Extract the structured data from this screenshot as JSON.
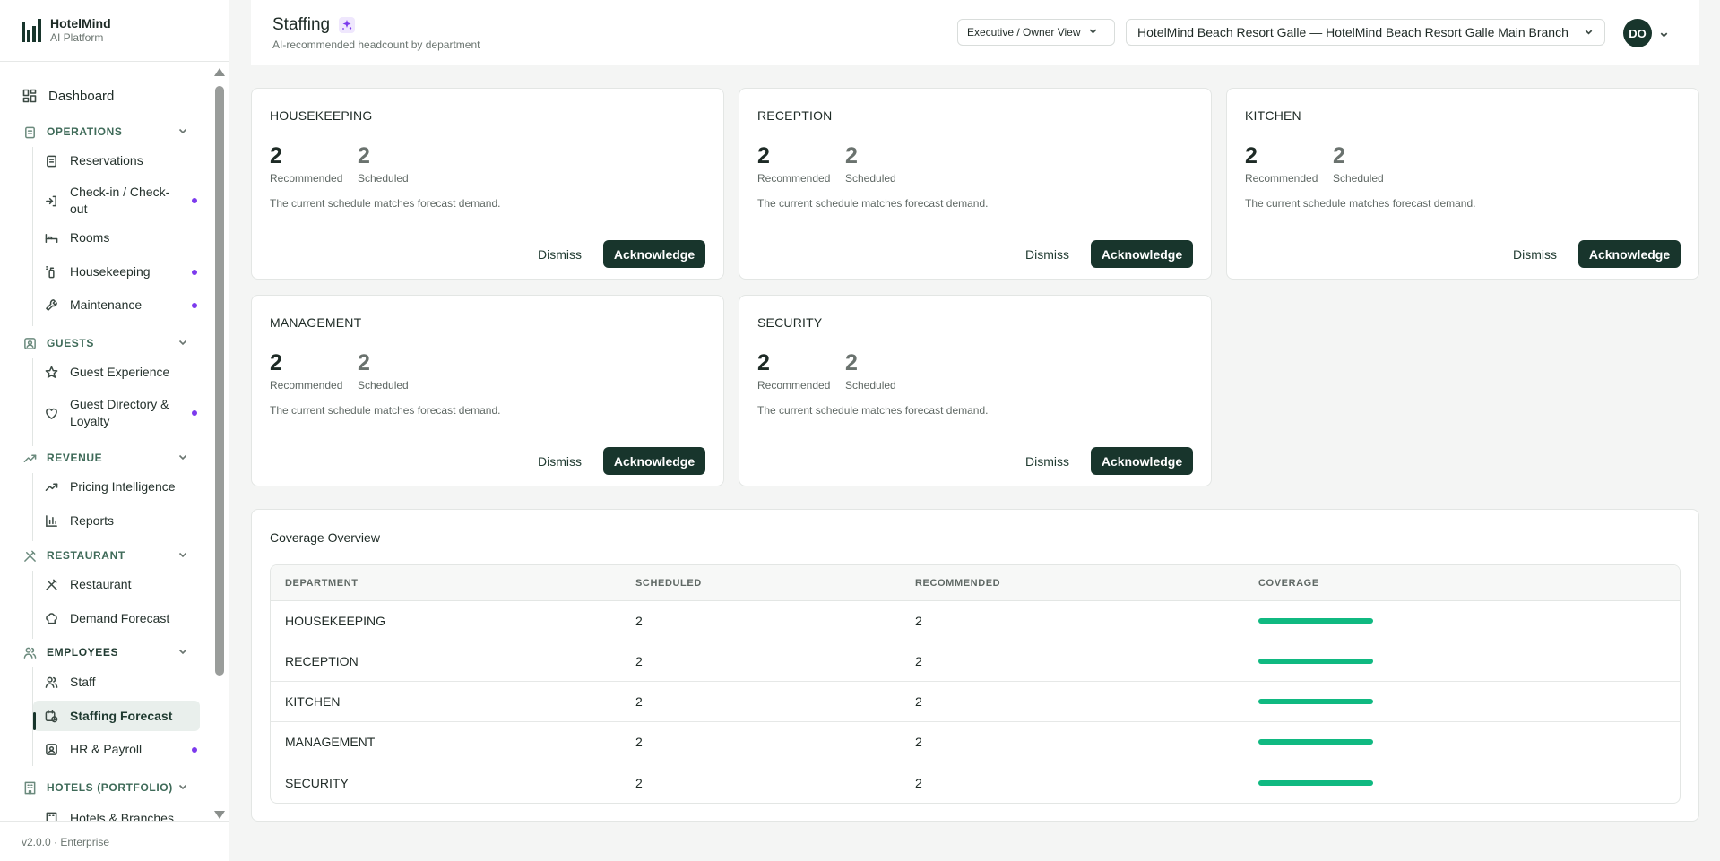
{
  "brand": {
    "name": "HotelMind",
    "sub": "AI Platform"
  },
  "nav": {
    "dashboard": "Dashboard",
    "sections": [
      {
        "label": "OPERATIONS",
        "items": [
          {
            "label": "Reservations",
            "dot": false
          },
          {
            "label": "Check-in / Check-out",
            "dot": true
          },
          {
            "label": "Rooms",
            "dot": false
          },
          {
            "label": "Housekeeping",
            "dot": true
          },
          {
            "label": "Maintenance",
            "dot": true
          }
        ]
      },
      {
        "label": "GUESTS",
        "items": [
          {
            "label": "Guest Experience",
            "dot": false
          },
          {
            "label": "Guest Directory & Loyalty",
            "dot": true
          }
        ]
      },
      {
        "label": "REVENUE",
        "items": [
          {
            "label": "Pricing Intelligence",
            "dot": false
          },
          {
            "label": "Reports",
            "dot": false
          }
        ]
      },
      {
        "label": "RESTAURANT",
        "items": [
          {
            "label": "Restaurant",
            "dot": false
          },
          {
            "label": "Demand Forecast",
            "dot": false
          }
        ]
      },
      {
        "label": "EMPLOYEES",
        "items": [
          {
            "label": "Staff",
            "dot": false
          },
          {
            "label": "Staffing Forecast",
            "dot": false,
            "active": true
          },
          {
            "label": "HR & Payroll",
            "dot": true
          }
        ]
      },
      {
        "label": "HOTELS (PORTFOLIO)",
        "items": [
          {
            "label": "Hotels & Branches",
            "dot": false
          }
        ]
      }
    ],
    "version": "v2.0.0 · Enterprise"
  },
  "header": {
    "title": "Staffing",
    "subtitle": "AI-recommended headcount by department",
    "view": "Executive / Owner View",
    "branch": "HotelMind Beach Resort Galle — HotelMind Beach Resort Galle Main Branch",
    "avatar": "DO"
  },
  "cards": [
    {
      "dept": "HOUSEKEEPING",
      "recommended": "2",
      "scheduled": "2",
      "rec_label": "Recommended",
      "sch_label": "Scheduled",
      "message": "The current schedule matches forecast demand.",
      "dismiss": "Dismiss",
      "ack": "Acknowledge"
    },
    {
      "dept": "RECEPTION",
      "recommended": "2",
      "scheduled": "2",
      "rec_label": "Recommended",
      "sch_label": "Scheduled",
      "message": "The current schedule matches forecast demand.",
      "dismiss": "Dismiss",
      "ack": "Acknowledge"
    },
    {
      "dept": "KITCHEN",
      "recommended": "2",
      "scheduled": "2",
      "rec_label": "Recommended",
      "sch_label": "Scheduled",
      "message": "The current schedule matches forecast demand.",
      "dismiss": "Dismiss",
      "ack": "Acknowledge"
    },
    {
      "dept": "MANAGEMENT",
      "recommended": "2",
      "scheduled": "2",
      "rec_label": "Recommended",
      "sch_label": "Scheduled",
      "message": "The current schedule matches forecast demand.",
      "dismiss": "Dismiss",
      "ack": "Acknowledge"
    },
    {
      "dept": "SECURITY",
      "recommended": "2",
      "scheduled": "2",
      "rec_label": "Recommended",
      "sch_label": "Scheduled",
      "message": "The current schedule matches forecast demand.",
      "dismiss": "Dismiss",
      "ack": "Acknowledge"
    }
  ],
  "coverage": {
    "title": "Coverage Overview",
    "columns": [
      "DEPARTMENT",
      "SCHEDULED",
      "RECOMMENDED",
      "COVERAGE"
    ],
    "rows": [
      {
        "dept": "HOUSEKEEPING",
        "scheduled": "2",
        "recommended": "2",
        "coverage": 1.0
      },
      {
        "dept": "RECEPTION",
        "scheduled": "2",
        "recommended": "2",
        "coverage": 1.0
      },
      {
        "dept": "KITCHEN",
        "scheduled": "2",
        "recommended": "2",
        "coverage": 1.0
      },
      {
        "dept": "MANAGEMENT",
        "scheduled": "2",
        "recommended": "2",
        "coverage": 1.0
      },
      {
        "dept": "SECURITY",
        "scheduled": "2",
        "recommended": "2",
        "coverage": 1.0
      }
    ]
  },
  "colors": {
    "brand": "#18352c",
    "accent_dot": "#7c3aed",
    "coverage_bar": "#10b981"
  }
}
